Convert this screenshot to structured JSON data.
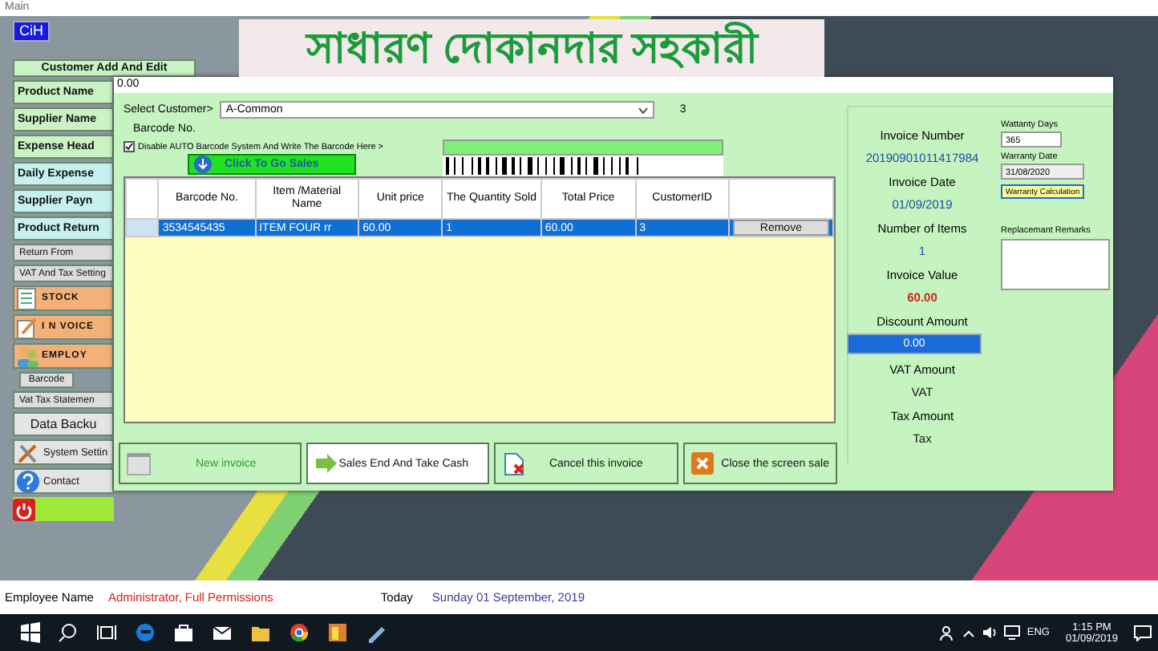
{
  "window": {
    "title": "Main"
  },
  "app_badge": "CiH",
  "banner": "সাধারণ দোকানদার সহকারী",
  "sidebar": {
    "items": [
      {
        "label": "Customer Add And Edit",
        "kind": "header"
      },
      {
        "label": "Product Name",
        "kind": "primary"
      },
      {
        "label": "Supplier Name",
        "kind": "primary"
      },
      {
        "label": "Expense Head",
        "kind": "primary"
      },
      {
        "label": "Daily Expense",
        "kind": "secondary"
      },
      {
        "label": "Supplier Payn",
        "kind": "secondary"
      },
      {
        "label": "Product Return",
        "kind": "secondary"
      },
      {
        "label": "Return From",
        "kind": "sub"
      },
      {
        "label": "VAT And Tax Setting",
        "kind": "sub"
      },
      {
        "label": "STOCK",
        "kind": "module"
      },
      {
        "label": "I N VOICE",
        "kind": "module"
      },
      {
        "label": "EMPLOY",
        "kind": "module"
      },
      {
        "label": "Barcode",
        "kind": "tab"
      },
      {
        "label": "Vat Tax Statemen",
        "kind": "sub"
      },
      {
        "label": "Data Backu",
        "kind": "plain"
      },
      {
        "label": "System Settin",
        "kind": "tool"
      },
      {
        "label": "Contact",
        "kind": "tool"
      },
      {
        "kind": "power"
      }
    ]
  },
  "dialog": {
    "title": "0.00",
    "customer": {
      "label": "Select Customer>",
      "value": "A-Common",
      "id": "3"
    },
    "barcode_label": "Barcode No.",
    "auto_barcode": {
      "label": "Disable AUTO Barcode System And Write The Barcode Here >",
      "checked": true
    },
    "go_sales_button": "Click To Go Sales",
    "table": {
      "columns": [
        "Barcode No.",
        "Item /Material Name",
        "Unit price",
        "The Quantity Sold",
        "Total Price",
        "CustomerID"
      ],
      "rows": [
        {
          "selected": true,
          "cells": [
            "3534545435",
            "ITEM FOUR rr",
            "60.00",
            "1",
            "60.00",
            "3"
          ],
          "action": "Remove"
        }
      ]
    },
    "buttons": [
      {
        "label": "New invoice",
        "kind": "new"
      },
      {
        "label": "Sales End And Take Cash",
        "kind": "cash"
      },
      {
        "label": "Cancel this invoice",
        "kind": "cancel"
      },
      {
        "label": "Close the screen sale",
        "kind": "close"
      }
    ],
    "summary": [
      {
        "label": "Invoice Number",
        "value": "20190901011417984",
        "kind": "info"
      },
      {
        "label": "Invoice Date",
        "value": "01/09/2019",
        "kind": "info"
      },
      {
        "label": "Number of Items",
        "value": "1",
        "kind": "info"
      },
      {
        "label": "Invoice Value",
        "value": "60.00",
        "kind": "total"
      },
      {
        "label": "Discount Amount",
        "value": "0.00",
        "kind": "field"
      },
      {
        "label": "VAT Amount",
        "value": "VAT",
        "kind": "plain"
      },
      {
        "label": "Tax Amount",
        "value": "Tax",
        "kind": "plain"
      }
    ],
    "warranty": {
      "days_label": "Wattanty Days",
      "days": "365",
      "date_label": "Warranty Date",
      "date": "31/08/2020",
      "button": "Warranty Calculation"
    },
    "remarks": {
      "label": "Replacemant Remarks"
    }
  },
  "status_bar": {
    "employee_label": "Employee Name",
    "employee": "Administrator, Full Permissions",
    "today_label": "Today",
    "today": "Sunday 01 September, 2019"
  },
  "taskbar": {
    "language": "ENG",
    "time": "1:15 PM",
    "date": "01/09/2019"
  }
}
